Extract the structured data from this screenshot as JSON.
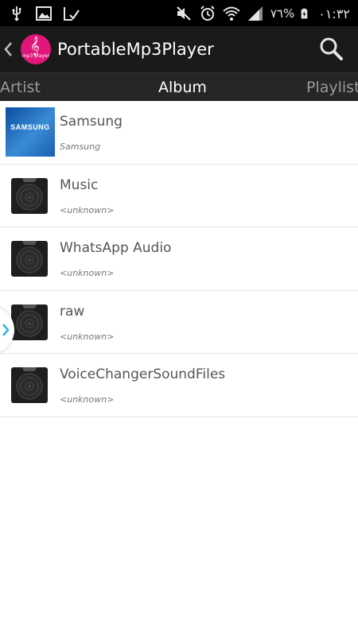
{
  "status_bar": {
    "battery_percent": "٧٦%",
    "time": "٠١:٣٢",
    "left_icons": [
      "usb-icon",
      "image-icon",
      "download-check-icon"
    ],
    "right_icons": [
      "mute-icon",
      "alarm-icon",
      "wifi-icon",
      "signal-icon",
      "battery-charging-icon"
    ]
  },
  "action_bar": {
    "title": "PortableMp3Player",
    "logo_text": "mp3 player",
    "logo_glyph": "𝄞"
  },
  "tabs": [
    {
      "label": "Artist",
      "active": false
    },
    {
      "label": "Album",
      "active": true
    },
    {
      "label": "Playlist",
      "active": false
    }
  ],
  "albums": [
    {
      "title": "Samsung",
      "subtitle": "Samsung",
      "thumb": "samsung-art",
      "thumb_text": "SAMSUNG"
    },
    {
      "title": "Music",
      "subtitle": "<unknown>",
      "thumb": "disc-icon"
    },
    {
      "title": "WhatsApp Audio",
      "subtitle": "<unknown>",
      "thumb": "disc-icon"
    },
    {
      "title": "raw",
      "subtitle": "<unknown>",
      "thumb": "disc-icon"
    },
    {
      "title": "VoiceChangerSoundFiles",
      "subtitle": "<unknown>",
      "thumb": "disc-icon"
    }
  ],
  "colors": {
    "action_bar": "#1a1a1a",
    "tabs_bar": "#262626",
    "logo": "#e2157a",
    "accent": "#33b5e5"
  }
}
